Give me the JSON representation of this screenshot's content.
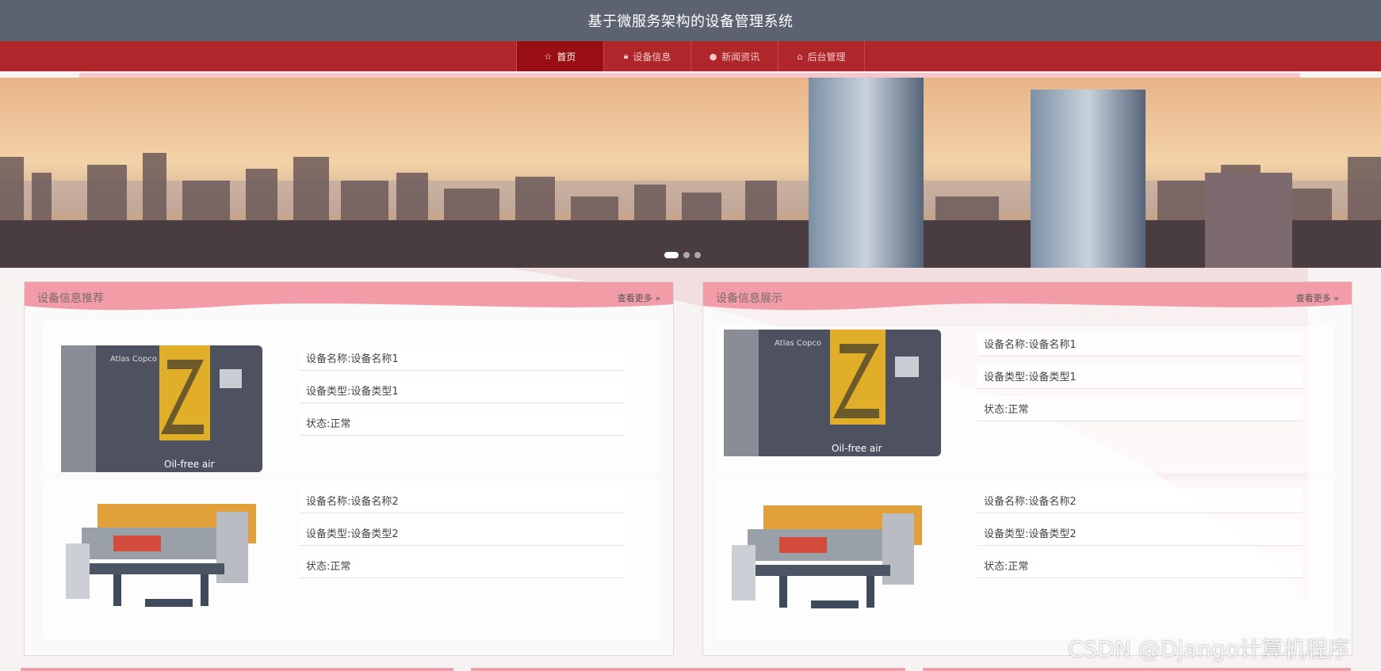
{
  "header": {
    "title": "基于微服务架构的设备管理系统"
  },
  "nav": {
    "items": [
      {
        "label": "首页",
        "icon": "star-icon",
        "active": true
      },
      {
        "label": "设备信息",
        "icon": "lock-icon",
        "active": false
      },
      {
        "label": "新闻资讯",
        "icon": "info-icon",
        "active": false
      },
      {
        "label": "后台管理",
        "icon": "home-icon",
        "active": false
      }
    ]
  },
  "colors": {
    "topbar": "#5d6270",
    "nav": "#b0272b",
    "nav_active": "#980e12",
    "panel_head": "#f29ca8"
  },
  "carousel": {
    "slide_count": 3,
    "active_index": 0
  },
  "panels": [
    {
      "title": "设备信息推荐",
      "more_label": "查看更多",
      "items": [
        {
          "name": "设备名称:设备名称1",
          "type": "设备类型:设备类型1",
          "status": "状态:正常",
          "image": "air-compressor"
        },
        {
          "name": "设备名称:设备名称2",
          "type": "设备类型:设备类型2",
          "status": "状态:正常",
          "image": "cutting-machine"
        }
      ]
    },
    {
      "title": "设备信息展示",
      "more_label": "查看更多",
      "items": [
        {
          "name": "设备名称:设备名称1",
          "type": "设备类型:设备类型1",
          "status": "状态:正常",
          "image": "air-compressor"
        },
        {
          "name": "设备名称:设备名称2",
          "type": "设备类型:设备类型2",
          "status": "状态:正常",
          "image": "cutting-machine"
        }
      ]
    }
  ],
  "watermark": "CSDN @Django计算机程序"
}
